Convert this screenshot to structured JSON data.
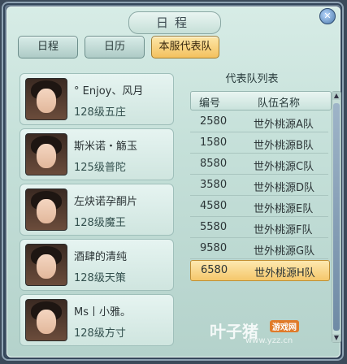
{
  "window": {
    "title": "日程",
    "close_icon": "close-icon"
  },
  "tabs": [
    {
      "label": "日程",
      "active": false
    },
    {
      "label": "日历",
      "active": false
    },
    {
      "label": "本服代表队",
      "active": true
    }
  ],
  "characters": [
    {
      "name": "° Enjoy、风月",
      "level": "128级五庄"
    },
    {
      "name": "斯米诺・觞玉",
      "level": "125级普陀"
    },
    {
      "name": "左炔诺孕酮片",
      "level": "128级魔王"
    },
    {
      "name": "酒肆的清纯",
      "level": "128级天策"
    },
    {
      "name": "Ms丨小雅。",
      "level": "128级方寸"
    }
  ],
  "team_list": {
    "title": "代表队列表",
    "headers": {
      "num": "编号",
      "name": "队伍名称"
    },
    "rows": [
      {
        "num": "2580",
        "name": "世外桃源A队"
      },
      {
        "num": "1580",
        "name": "世外桃源B队"
      },
      {
        "num": "8580",
        "name": "世外桃源C队"
      },
      {
        "num": "3580",
        "name": "世外桃源D队"
      },
      {
        "num": "4580",
        "name": "世外桃源E队"
      },
      {
        "num": "5580",
        "name": "世外桃源F队"
      },
      {
        "num": "9580",
        "name": "世外桃源G队"
      },
      {
        "num": "6580",
        "name": "世外桃源H队",
        "selected": true
      }
    ]
  },
  "watermark": {
    "text": "叶子猪",
    "tag": "游戏网",
    "url": "www.yzz.cn"
  }
}
